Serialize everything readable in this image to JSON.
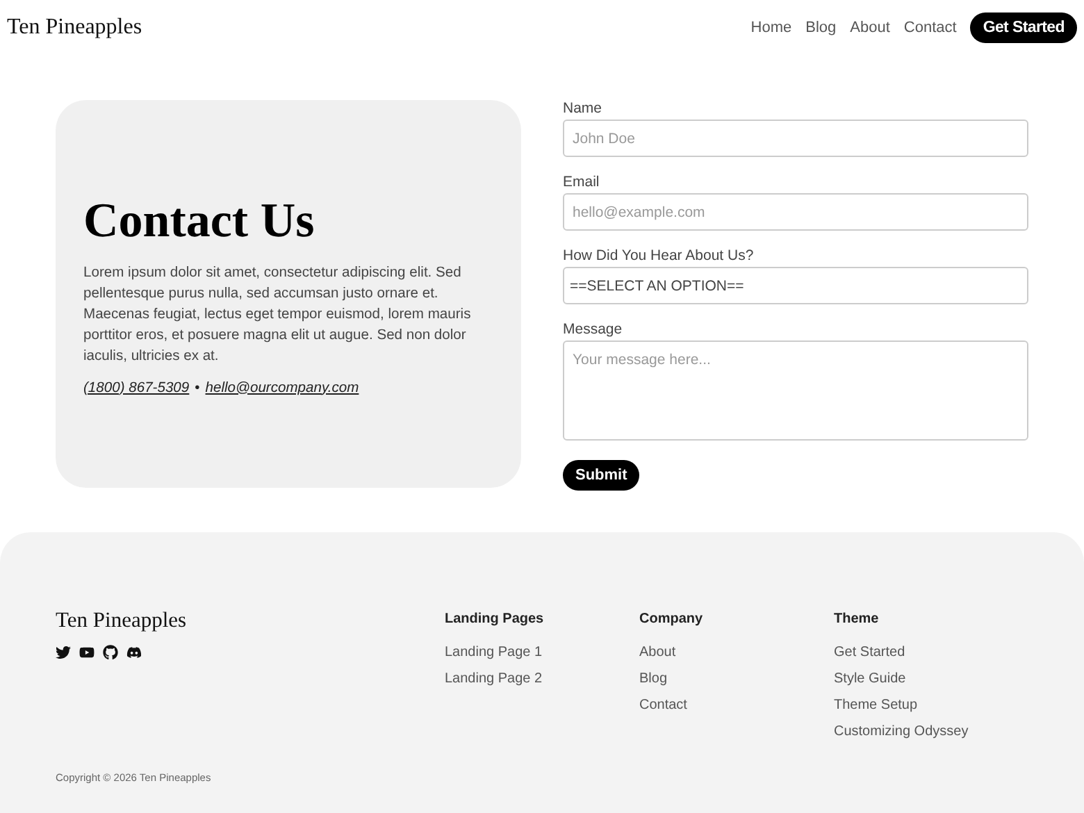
{
  "header": {
    "brand": "Ten Pineapples",
    "nav": [
      "Home",
      "Blog",
      "About",
      "Contact"
    ],
    "cta": "Get Started"
  },
  "contact": {
    "title": "Contact Us",
    "body": "Lorem ipsum dolor sit amet, consectetur adipiscing elit. Sed pellentesque purus nulla, sed accumsan justo ornare et. Maecenas feugiat, lectus eget tempor euismod, lorem mauris porttitor eros, et posuere magna elit ut augue. Sed non dolor iaculis, ultricies ex at.",
    "phone": "(1800) 867-5309",
    "separator": "•",
    "email": "hello@ourcompany.com"
  },
  "form": {
    "fields": [
      {
        "kind": "input",
        "label": "Name",
        "placeholder": "John Doe"
      },
      {
        "kind": "input",
        "label": "Email",
        "placeholder": "hello@example.com"
      },
      {
        "kind": "select",
        "label": "How Did You Hear About Us?",
        "value": "==SELECT AN OPTION=="
      },
      {
        "kind": "textarea",
        "label": "Message",
        "placeholder": "Your message here..."
      }
    ],
    "submit": "Submit"
  },
  "footer": {
    "brand": "Ten Pineapples",
    "social": [
      {
        "kind": "twitter"
      },
      {
        "kind": "youtube"
      },
      {
        "kind": "github"
      },
      {
        "kind": "discord"
      }
    ],
    "columns": [
      {
        "title": "Landing Pages",
        "links": [
          "Landing Page 1",
          "Landing Page 2"
        ]
      },
      {
        "title": "Company",
        "links": [
          "About",
          "Blog",
          "Contact"
        ]
      },
      {
        "title": "Theme",
        "links": [
          "Get Started",
          "Style Guide",
          "Theme Setup",
          "Customizing Odyssey"
        ]
      }
    ],
    "copyright": "Copyright © 2026 Ten Pineapples"
  }
}
